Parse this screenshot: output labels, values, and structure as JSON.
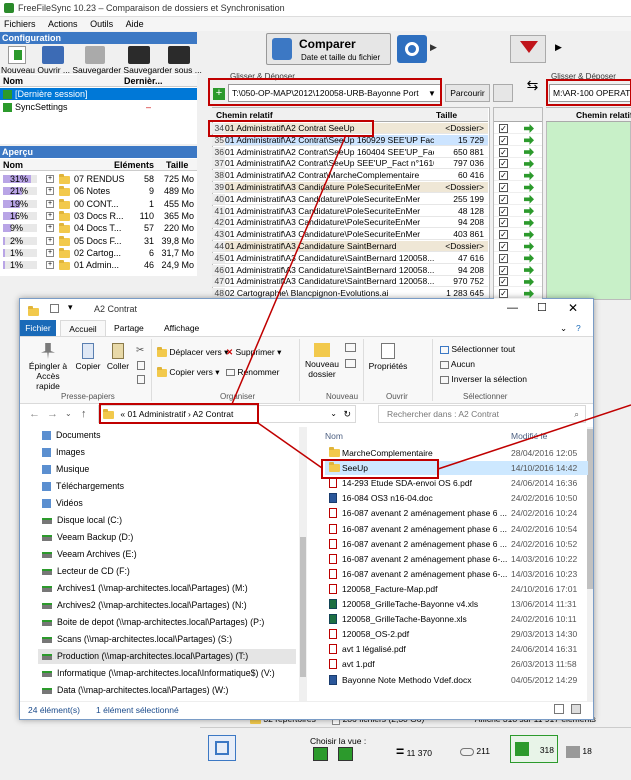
{
  "ffs": {
    "title": "FreeFileSync 10.23 – Comparaison de dossiers et Synchronisation",
    "menu": [
      "Fichiers",
      "Actions",
      "Outils",
      "Aide"
    ],
    "config": {
      "header": "Configuration",
      "buttons": [
        "Nouveau",
        "Ouvrir ...",
        "Sauvegarder",
        "Sauvegarder sous ..."
      ],
      "col_name": "Nom",
      "col_last": "Dernièr...",
      "items": [
        {
          "name": "[Dernière session]",
          "last": ""
        },
        {
          "name": "SyncSettings",
          "last": "–"
        }
      ]
    },
    "overview": {
      "header": "Aperçu",
      "col_name": "Nom",
      "col_items": "Eléments",
      "col_size": "Taille",
      "rows": [
        {
          "pct": "31%",
          "name": "07 RENDUS",
          "items": "58",
          "size": "725 Mo"
        },
        {
          "pct": "21%",
          "name": "06 Notes",
          "items": "9",
          "size": "489 Mo"
        },
        {
          "pct": "19%",
          "name": "00 CONT...",
          "items": "1",
          "size": "455 Mo"
        },
        {
          "pct": "16%",
          "name": "03 Docs R...",
          "items": "110",
          "size": "365 Mo"
        },
        {
          "pct": "9%",
          "name": "04 Docs T...",
          "items": "57",
          "size": "220 Mo"
        },
        {
          "pct": "2%",
          "name": "05 Docs F...",
          "items": "31",
          "size": "39,8 Mo"
        },
        {
          "pct": "1%",
          "name": "02 Cartog...",
          "items": "6",
          "size": "31,7 Mo"
        },
        {
          "pct": "1%",
          "name": "01 Admin...",
          "items": "46",
          "size": "24,9 Mo"
        }
      ]
    },
    "compare": {
      "label": "Comparer",
      "sub": "Date et taille du fichier"
    },
    "left_folder": {
      "label": "Glisser & Déposer",
      "path": "T:\\050-OP-MAP\\2012\\120058-URB-Bayonne Port",
      "browse": "Parcourir"
    },
    "right_folder": {
      "label": "Glisser & Déposer",
      "path": "M:\\AR-100 OPERATI"
    },
    "grid": {
      "col_path": "Chemin relatif",
      "col_size": "Taille",
      "col_path_right": "Chemin relatif",
      "rows": [
        {
          "n": "34",
          "path": "01 Administratif\\A2 Contrat   SeeUp",
          "size": "<Dossier>"
        },
        {
          "n": "35",
          "path": "01 Administratif\\A2 Contrat\\SeeUp  160929 SEE'UP Fac...",
          "size": "15 729"
        },
        {
          "n": "36",
          "path": "01 Administratif\\A2 Contrat\\SeeUp  160404 SEE'UP_Fact...",
          "size": "650 881"
        },
        {
          "n": "37",
          "path": "01 Administratif\\A2 Contrat\\SeeUp  SEE'UP_Fact n°1610...",
          "size": "797 036"
        },
        {
          "n": "38",
          "path": "01 Administratif\\A2 Contrat\\MarcheComplementaire",
          "size": "60 416"
        },
        {
          "n": "39",
          "path": "01 Administratif\\A3 Candidature   PoleSecuriteEnMer",
          "size": "<Dossier>"
        },
        {
          "n": "40",
          "path": "01 Administratif\\A3 Candidature\\PoleSecuriteEnMer",
          "size": "255 199"
        },
        {
          "n": "41",
          "path": "01 Administratif\\A3 Candidature\\PoleSecuriteEnMer",
          "size": "48 128"
        },
        {
          "n": "42",
          "path": "01 Administratif\\A3 Candidature\\PoleSecuriteEnMer",
          "size": "94 208"
        },
        {
          "n": "43",
          "path": "01 Administratif\\A3 Candidature\\PoleSecuriteEnMer",
          "size": "403 861"
        },
        {
          "n": "44",
          "path": "01 Administratif\\A3 Candidature   SaintBernard",
          "size": "<Dossier>"
        },
        {
          "n": "45",
          "path": "01 Administratif\\A3 Candidature\\SaintBernard    120058...",
          "size": "47 616"
        },
        {
          "n": "46",
          "path": "01 Administratif\\A3 Candidature\\SaintBernard    120058...",
          "size": "94 208"
        },
        {
          "n": "47",
          "path": "01 Administratif\\A3 Candidature\\SaintBernard    120058...",
          "size": "970 752"
        },
        {
          "n": "48",
          "path": "02 Cartographie\\    Blancpignon-Evolutions.ai",
          "size": "1 283 645"
        }
      ]
    },
    "status": {
      "dirs": "32 répertoires",
      "files": "286 fichiers (2,30 Go)",
      "display": "Affiche 318 sur 11 917 éléments"
    },
    "bottom": {
      "view_label": "Choisir la vue :",
      "equal_count": "11 370",
      "diff_count": "211",
      "right_count": "318",
      "right2_count": "18"
    }
  },
  "explorer": {
    "title": "A2 Contrat",
    "tabs": [
      "Fichier",
      "Accueil",
      "Partage",
      "Affichage"
    ],
    "ribbon": {
      "pin": "Épingler à Accès rapide",
      "copy": "Copier",
      "paste": "Coller",
      "group_clipboard": "Presse-papiers",
      "move_to": "Déplacer vers",
      "copy_to": "Copier vers",
      "delete": "Supprimer",
      "rename": "Renommer",
      "group_organize": "Organiser",
      "new_folder": "Nouveau dossier",
      "group_new": "Nouveau",
      "properties": "Propriétés",
      "group_open": "Ouvrir",
      "select_all": "Sélectionner tout",
      "select_none": "Aucun",
      "invert": "Inverser la sélection",
      "group_select": "Sélectionner"
    },
    "address": {
      "seg1": "01 Administratif",
      "seg2": "A2 Contrat"
    },
    "search_placeholder": "Rechercher dans : A2 Contrat",
    "nav": [
      "Documents",
      "Images",
      "Musique",
      "Téléchargements",
      "Vidéos",
      "Disque local (C:)",
      "Veeam Backup (D:)",
      "Veeam Archives (E:)",
      "Lecteur de CD (F:)",
      "Archives1 (\\\\map-architectes.local\\Partages) (M:)",
      "Archives2 (\\\\map-architectes.local\\Partages) (N:)",
      "Boite de depot (\\\\map-architectes.local\\Partages) (P:)",
      "Scans (\\\\map-architectes.local\\Partages) (S:)",
      "Production (\\\\map-architectes.local\\Partages) (T:)",
      "Informatique (\\\\map-architectes.local\\Informatique$) (V:)",
      "Data (\\\\map-architectes.local\\Partages) (W:)"
    ],
    "col_name": "Nom",
    "col_date": "Modifié le",
    "files": [
      {
        "name": "MarcheComplementaire",
        "date": "28/04/2016 12:05",
        "type": "folder"
      },
      {
        "name": "SeeUp",
        "date": "14/10/2016 14:42",
        "type": "folder"
      },
      {
        "name": "14-293 Etude SDA-envoi OS 6.pdf",
        "date": "24/06/2014 16:36",
        "type": "pdf"
      },
      {
        "name": "16-084 OS3 n16-04.doc",
        "date": "24/02/2016 10:50",
        "type": "doc"
      },
      {
        "name": "16-087 avenant 2 aménagement phase 6 ...",
        "date": "24/02/2016 10:24",
        "type": "pdf"
      },
      {
        "name": "16-087 avenant 2 aménagement phase 6 ...",
        "date": "24/02/2016 10:54",
        "type": "pdf"
      },
      {
        "name": "16-087 avenant 2 aménagement phase 6 ...",
        "date": "24/02/2016 10:52",
        "type": "pdf"
      },
      {
        "name": "16-087 avenant 2 aménagement phase 6-...",
        "date": "14/03/2016 10:22",
        "type": "pdf"
      },
      {
        "name": "16-087 avenant 2 aménagement phase 6-...",
        "date": "14/03/2016 10:23",
        "type": "pdf"
      },
      {
        "name": "120058_Facture-Map.pdf",
        "date": "24/10/2016 17:01",
        "type": "pdf"
      },
      {
        "name": "120058_GrilleTache-Bayonne v4.xls",
        "date": "13/06/2014 11:31",
        "type": "xls"
      },
      {
        "name": "120058_GrilleTache-Bayonne.xls",
        "date": "24/02/2016 10:11",
        "type": "xls"
      },
      {
        "name": "120058_OS-2.pdf",
        "date": "29/03/2013 14:30",
        "type": "pdf"
      },
      {
        "name": "avt 1 légalisé.pdf",
        "date": "24/06/2014 16:31",
        "type": "pdf"
      },
      {
        "name": "avt 1.pdf",
        "date": "26/03/2013 11:58",
        "type": "pdf"
      },
      {
        "name": "Bayonne Note Methodo Vdef.docx",
        "date": "04/05/2012 14:29",
        "type": "doc"
      }
    ],
    "status_count": "24 élément(s)",
    "status_selected": "1 élément sélectionné"
  },
  "colors": {
    "accent": "#3c78c4",
    "highlight_red": "#c00000",
    "selection": "#cde8ff"
  }
}
